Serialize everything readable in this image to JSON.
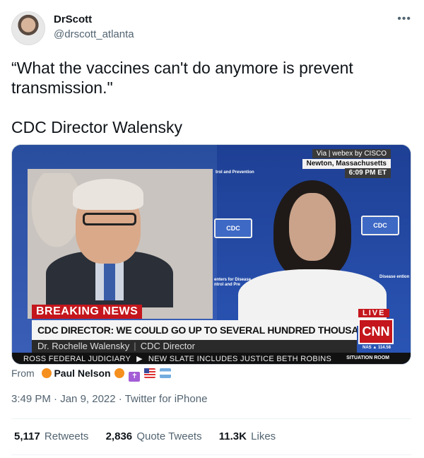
{
  "author": {
    "display_name": "DrScott",
    "handle": "@drscott_atlanta",
    "more_icon": "ellipsis-icon"
  },
  "tweet": {
    "text_line1": "“What the vaccines can't do anymore is prevent",
    "text_line2": "transmission.\"",
    "attribution": "CDC Director Walensky"
  },
  "media": {
    "via": "Via | webex by CISCO",
    "location": "Newton, Massachusetts",
    "time": "6:09 PM ET",
    "breaking": "BREAKING NEWS",
    "live": "LIVE",
    "headline": "CDC DIRECTOR: WE COULD GO UP TO SEVERAL HUNDRED THOUSAND CASES A DAY",
    "name": "Dr. Rochelle Walensky",
    "title": "CDC Director",
    "network": "CNN",
    "nas": "NAS ▲ 114.58",
    "ticker_left": "ROSS FEDERAL JUDICIARY",
    "ticker_right": "NEW SLATE INCLUDES JUSTICE BETH ROBINS",
    "show": "SITUATION ROOM",
    "cdc_logo_text": "CDC",
    "backdrop_top": "trol and Prevention",
    "backdrop_left": "enters for Disease ntrol and Pre",
    "backdrop_right": "Disease ention"
  },
  "source": {
    "from_label": "From",
    "user": "Paul Nelson"
  },
  "meta": {
    "time": "3:49 PM",
    "date": "Jan 9, 2022",
    "client": "Twitter for iPhone"
  },
  "stats": {
    "retweets_count": "5,117",
    "retweets_label": "Retweets",
    "quotes_count": "2,836",
    "quotes_label": "Quote Tweets",
    "likes_count": "11.3K",
    "likes_label": "Likes"
  }
}
